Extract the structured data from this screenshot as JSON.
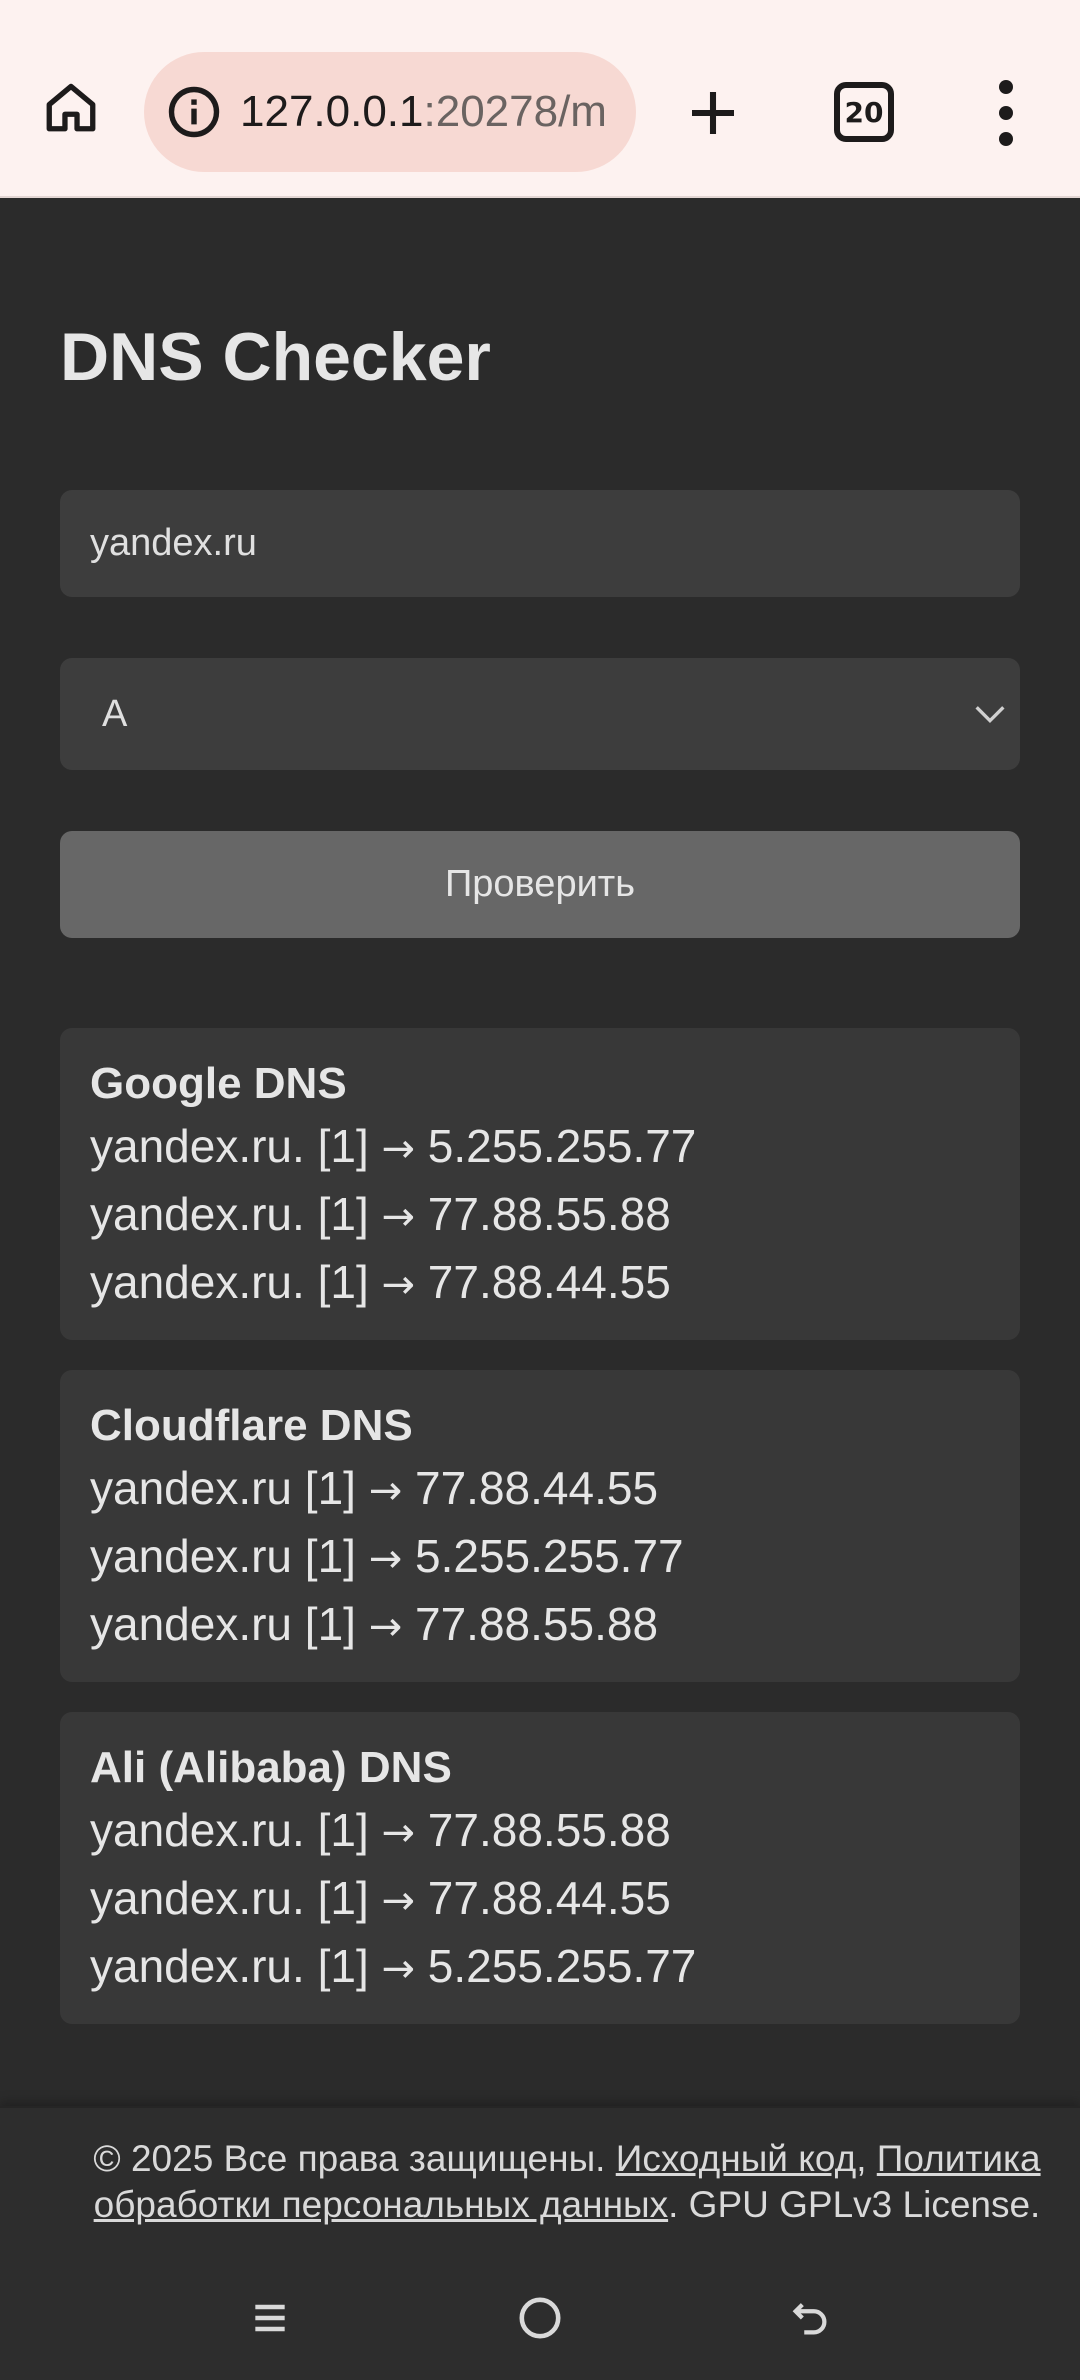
{
  "browser": {
    "url_host": "127.0.0.1",
    "url_rest": ":20278/m",
    "tab_count": "20"
  },
  "page": {
    "title": "DNS Checker",
    "domain_input": {
      "value": "yandex.ru",
      "placeholder": ""
    },
    "record_type": {
      "selected": "A"
    },
    "check_button_label": "Проверить"
  },
  "results": [
    {
      "provider": "Google DNS",
      "records": [
        {
          "name": "yandex.ru. [1]",
          "arrow": "→",
          "ip": "5.255.255.77"
        },
        {
          "name": "yandex.ru. [1]",
          "arrow": "→",
          "ip": "77.88.55.88"
        },
        {
          "name": "yandex.ru. [1]",
          "arrow": "→",
          "ip": "77.88.44.55"
        }
      ]
    },
    {
      "provider": "Cloudflare DNS",
      "records": [
        {
          "name": "yandex.ru [1]",
          "arrow": "→",
          "ip": "77.88.44.55"
        },
        {
          "name": "yandex.ru [1]",
          "arrow": "→",
          "ip": "5.255.255.77"
        },
        {
          "name": "yandex.ru [1]",
          "arrow": "→",
          "ip": "77.88.55.88"
        }
      ]
    },
    {
      "provider": "Ali (Alibaba) DNS",
      "records": [
        {
          "name": "yandex.ru. [1]",
          "arrow": "→",
          "ip": "77.88.55.88"
        },
        {
          "name": "yandex.ru. [1]",
          "arrow": "→",
          "ip": "77.88.44.55"
        },
        {
          "name": "yandex.ru. [1]",
          "arrow": "→",
          "ip": "5.255.255.77"
        }
      ]
    }
  ],
  "footer": {
    "copyright": "© 2025 Все права защищены.",
    "source_link": "Исходный код",
    "separator": ",",
    "privacy_link": "Политика обработки персональных данных",
    "license": ". GPU GPLv3 License."
  },
  "icons": {
    "home": "home-icon",
    "info": "info-icon",
    "new_tab": "plus-icon",
    "menu": "more-vert-icon",
    "chevron": "chevron-down-icon",
    "recents": "recents-icon",
    "nav_home": "circle-home-icon",
    "back": "back-icon"
  },
  "colors": {
    "background": "#2b2b2b",
    "field": "#3d3d3d",
    "button": "#676767",
    "card": "#383838",
    "browser_bar": "#fdf2f0",
    "url_pill": "#f7d9d3"
  }
}
